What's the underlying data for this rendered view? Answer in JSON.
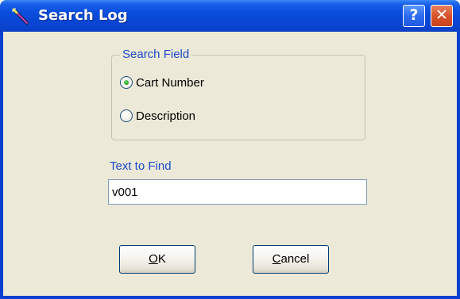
{
  "window": {
    "title": "Search Log",
    "icon": "wand-icon",
    "help_button": "?",
    "close_button": "✕"
  },
  "search_field": {
    "legend": "Search Field",
    "options": [
      {
        "label": "Cart Number",
        "selected": true
      },
      {
        "label": "Description",
        "selected": false
      }
    ]
  },
  "find": {
    "label": "Text to Find",
    "value": "v001"
  },
  "buttons": {
    "ok": {
      "mnemonic": "O",
      "rest": "K"
    },
    "cancel": {
      "mnemonic": "C",
      "rest": "ancel"
    }
  },
  "colors": {
    "titlebar": "#0a44cf",
    "accent_text": "#1b49c9",
    "dialog_face": "#ece9d8",
    "close_button": "#d8542c",
    "radio_selected": "#21a121"
  }
}
